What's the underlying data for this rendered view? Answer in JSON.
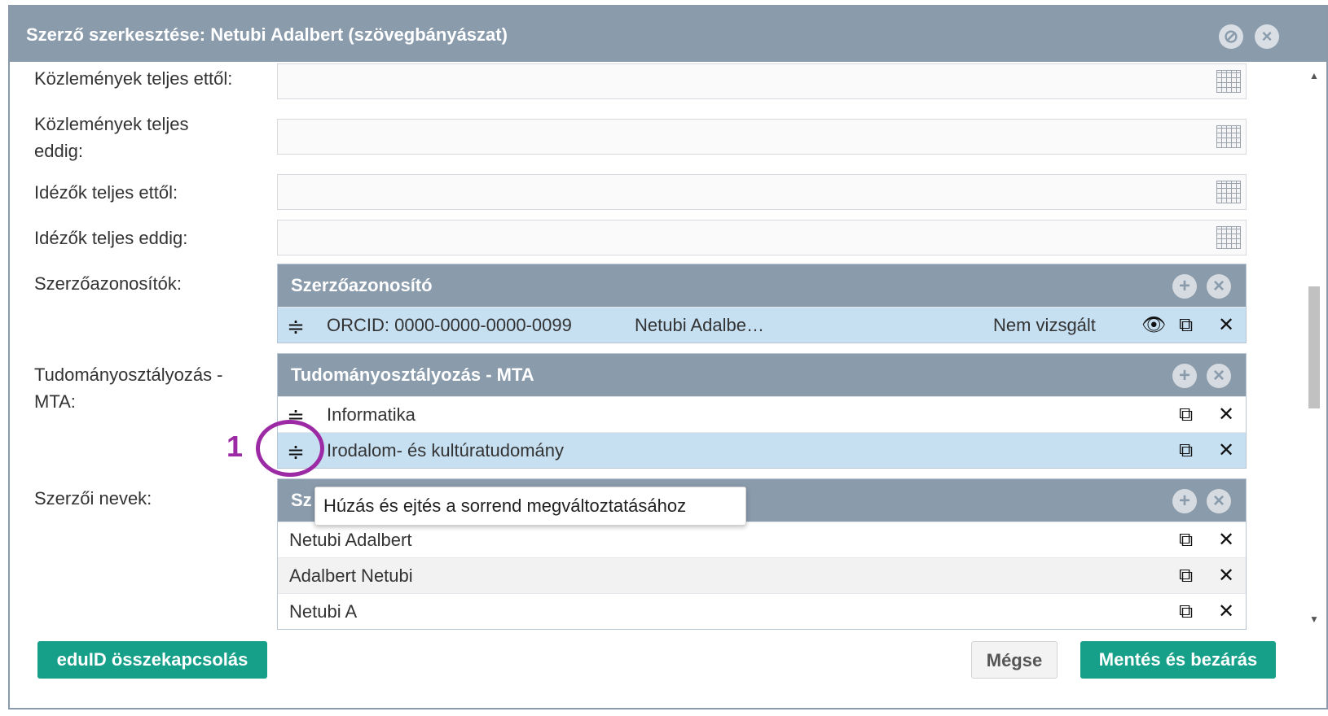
{
  "dialog": {
    "title": "Szerző szerkesztése: Netubi Adalbert (szövegbányászat)",
    "minimize_icon": "minimize-icon",
    "close_icon": "close-icon"
  },
  "fields": {
    "pub_from_label": "Közlemények teljes ettől:",
    "pub_to_label_line1": "Közlemények teljes",
    "pub_to_label_line2": "eddig:",
    "cit_from_label": "Idézők teljes ettől:",
    "cit_to_label": "Idézők teljes eddig:",
    "author_ids_label": "Szerzőazonosítók:",
    "science_label_line1": "Tudományosztályozás -",
    "science_label_line2": "MTA:",
    "names_label": "Szerzői nevek:"
  },
  "author_ids_panel": {
    "header": "Szerzőazonosító",
    "rows": [
      {
        "id": "ORCID: 0000-0000-0000-0099",
        "name": "Netubi Adalbe…",
        "status": "Nem vizsgált"
      }
    ]
  },
  "science_panel": {
    "header": "Tudományosztályozás - MTA",
    "rows": [
      {
        "label": "Informatika"
      },
      {
        "label": "Irodalom- és kultúratudomány"
      }
    ]
  },
  "names_panel": {
    "header": "Sz",
    "rows": [
      {
        "label": "Netubi Adalbert"
      },
      {
        "label": "Adalbert Netubi"
      },
      {
        "label": "Netubi A"
      }
    ]
  },
  "tooltip": "Húzás és ejtés a sorrend megváltoztatásához",
  "annotation": "1",
  "buttons": {
    "eduid": "eduID összekapcsolás",
    "cancel": "Mégse",
    "save": "Mentés és bezárás"
  },
  "glyphs": {
    "drag": "≑",
    "plus": "+",
    "close": "×",
    "edit": "⧉",
    "remove": "✕",
    "eye": "👁",
    "up": "▲",
    "down": "▼"
  },
  "colors": {
    "header": "#8a9bac",
    "selected_row": "#c6dff1",
    "accent": "#16a089",
    "annotation": "#9b2aa4"
  }
}
